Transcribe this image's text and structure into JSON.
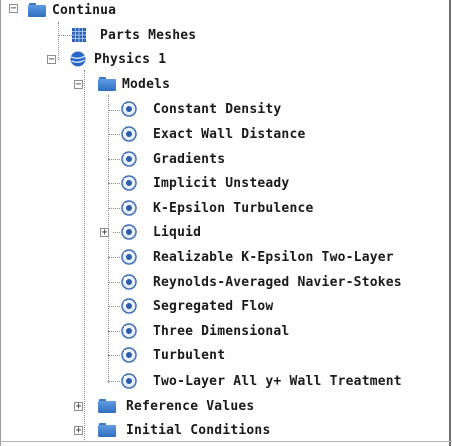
{
  "tree": {
    "continua": "Continua",
    "parts_meshes": "Parts Meshes",
    "physics": "Physics 1",
    "models_folder": "Models",
    "models": [
      "Constant Density",
      "Exact Wall Distance",
      "Gradients",
      "Implicit Unsteady",
      "K-Epsilon Turbulence",
      "Liquid",
      "Realizable K-Epsilon Two-Layer",
      "Reynolds-Averaged Navier-Stokes",
      "Segregated Flow",
      "Three Dimensional",
      "Turbulent",
      "Two-Layer All y+ Wall Treatment"
    ],
    "reference_values": "Reference Values",
    "initial_conditions": "Initial Conditions",
    "expand_glyph": "+",
    "collapse_glyph": "−"
  }
}
